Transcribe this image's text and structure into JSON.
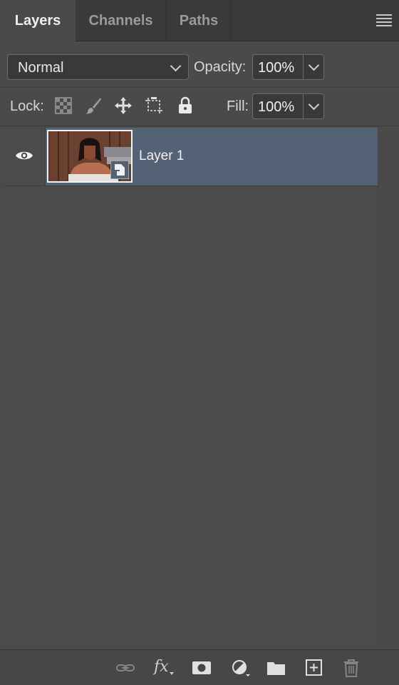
{
  "tabs": [
    {
      "label": "Layers",
      "active": true
    },
    {
      "label": "Channels",
      "active": false
    },
    {
      "label": "Paths",
      "active": false
    }
  ],
  "blend_mode": {
    "value": "Normal"
  },
  "opacity": {
    "label": "Opacity:",
    "value": "100%"
  },
  "lock": {
    "label": "Lock:",
    "icons": [
      "lock-transparent-pixels-icon",
      "lock-image-pixels-icon",
      "lock-position-icon",
      "prevent-auto-nesting-icon",
      "lock-all-icon"
    ]
  },
  "fill": {
    "label": "Fill:",
    "value": "100%"
  },
  "layers": [
    {
      "name": "Layer 1",
      "visible": true,
      "selected": true,
      "smart_object": true
    }
  ],
  "bottom_bar": {
    "icons": [
      "link-layers-icon",
      "layer-style-fx-icon",
      "add-mask-icon",
      "adjustment-layer-icon",
      "new-group-icon",
      "new-layer-icon",
      "delete-layer-icon"
    ],
    "fx_text": "fx"
  },
  "colors": {
    "panel_bg": "#4a4a4a",
    "tabbar_bg": "#3a3a3a",
    "selection": "#536274",
    "text": "#d6d6d6"
  }
}
